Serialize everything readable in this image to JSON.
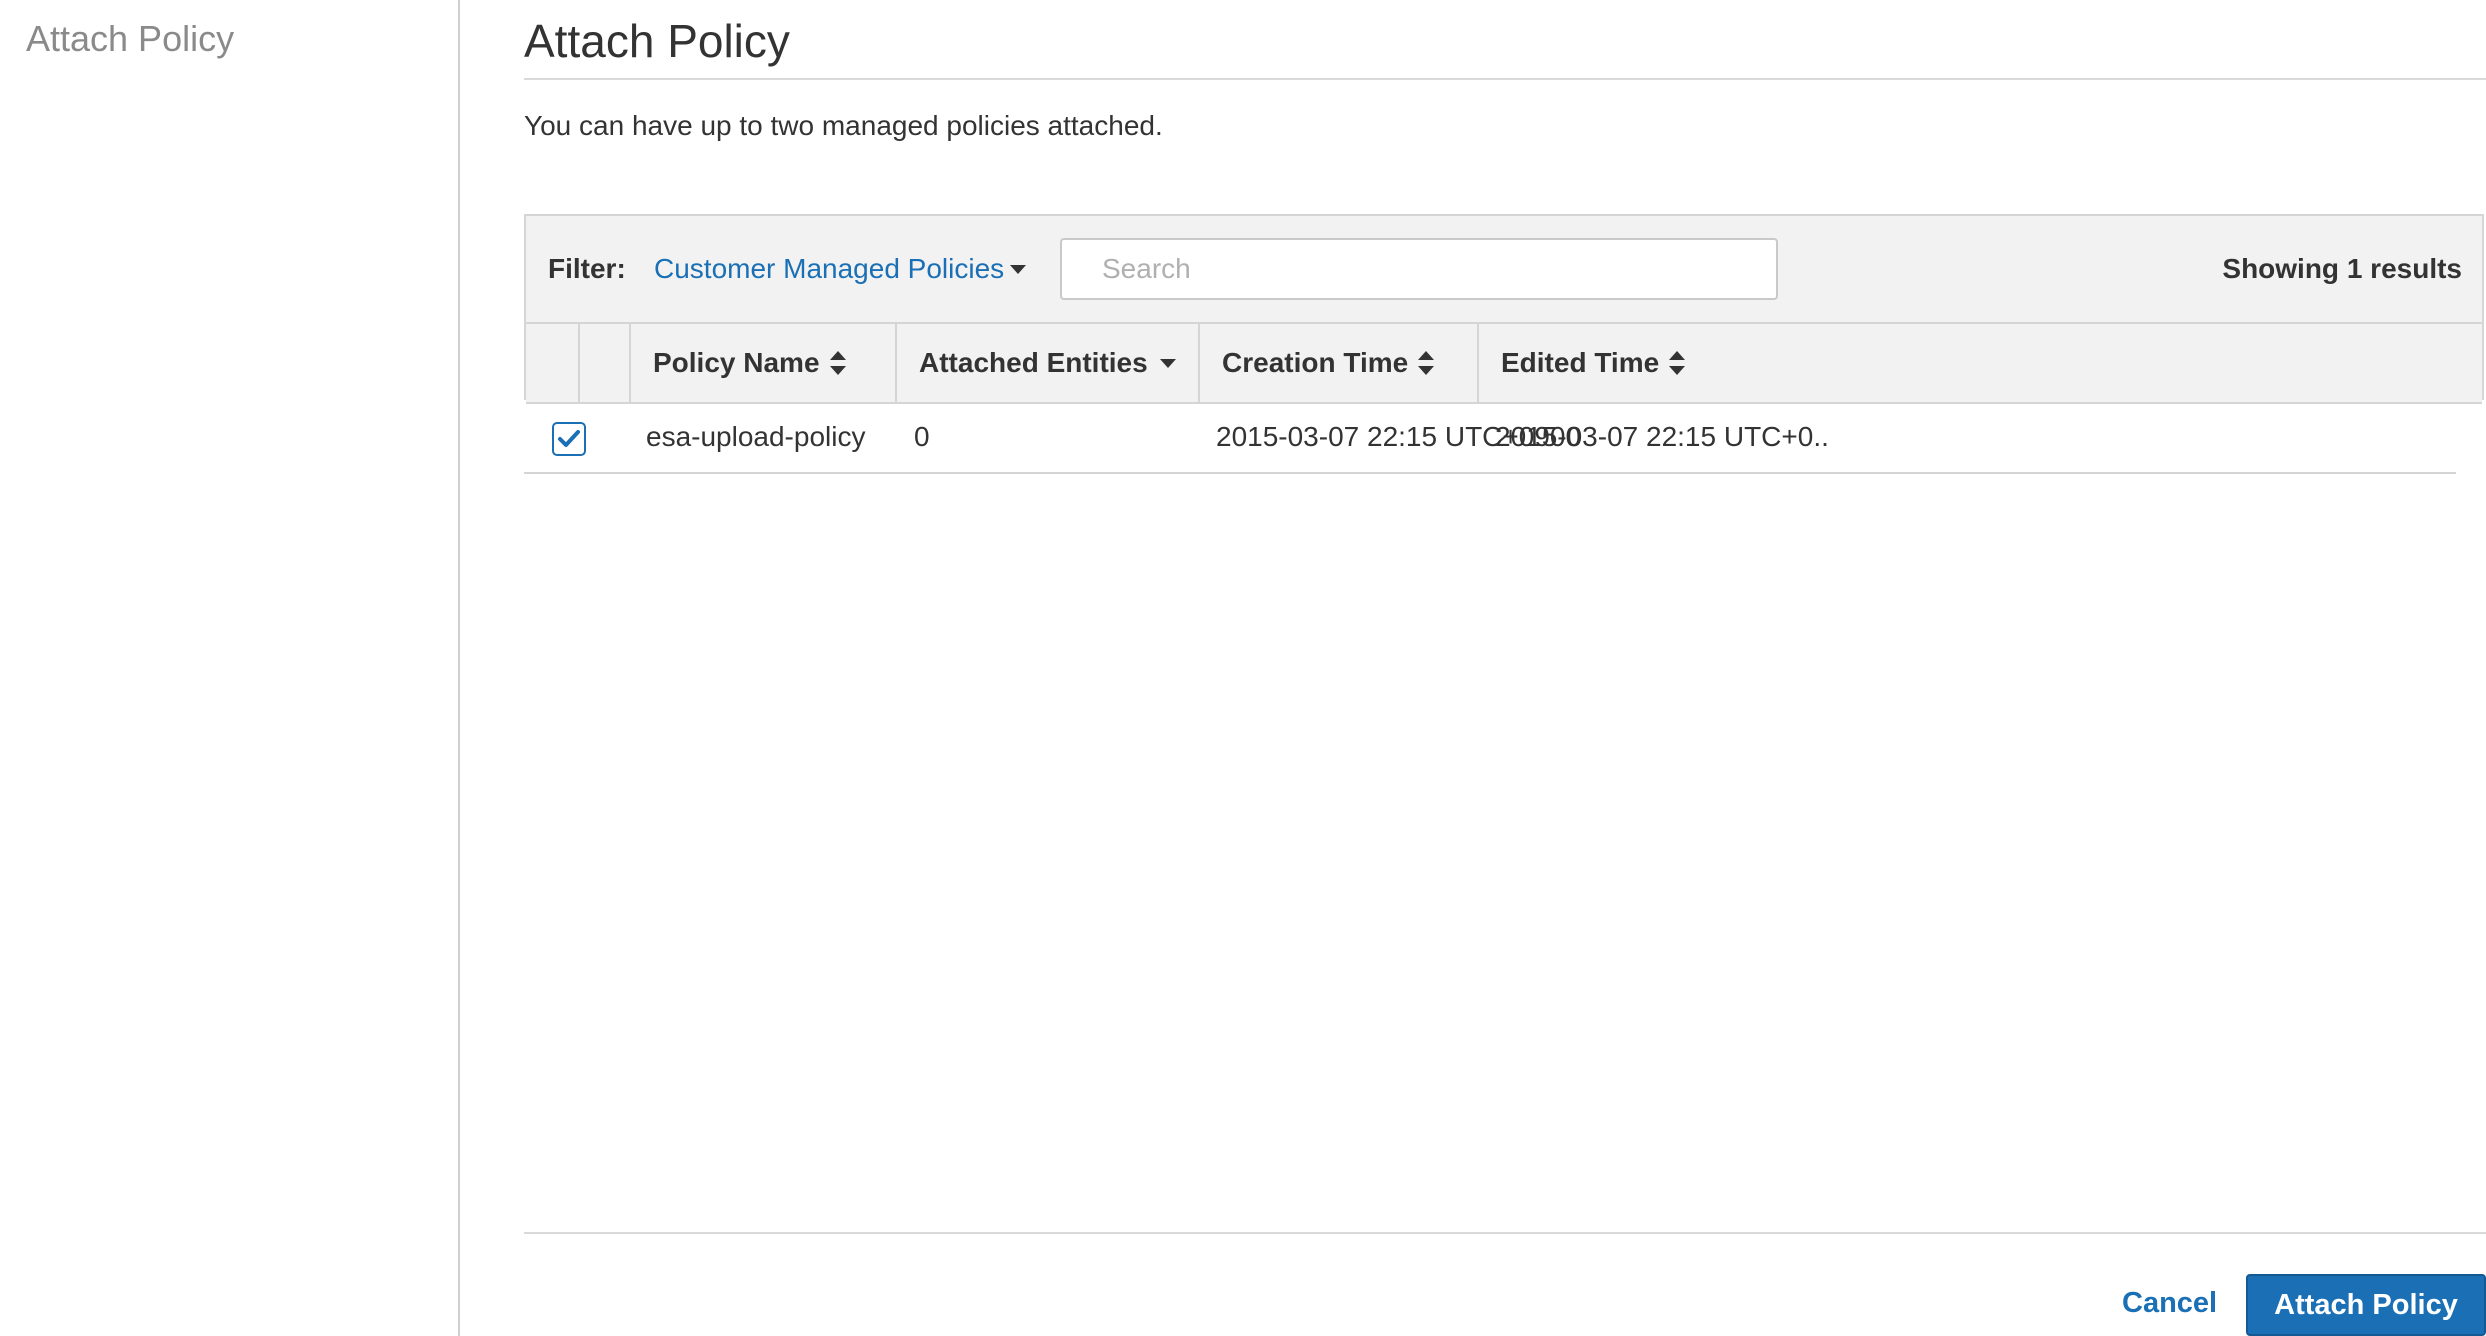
{
  "sidebar": {
    "title": "Attach Policy"
  },
  "page": {
    "title": "Attach Policy",
    "description": "You can have up to two managed policies attached."
  },
  "filter": {
    "label": "Filter:",
    "selected": "Customer Managed Policies",
    "search_placeholder": "Search",
    "search_value": "",
    "results": "Showing 1 results"
  },
  "table": {
    "columns": [
      "Policy Name",
      "Attached Entities",
      "Creation Time",
      "Edited Time"
    ],
    "rows": [
      {
        "checked": true,
        "policy_name": "esa-upload-policy",
        "attached_entities": "0",
        "creation_time": "2015-03-07 22:15 UTC+0900",
        "edited_time": "2015-03-07 22:15 UTC+0.."
      }
    ]
  },
  "footer": {
    "cancel_label": "Cancel",
    "attach_label": "Attach Policy"
  },
  "colors": {
    "accent": "#1a6fb5",
    "header_bg": "#f2f2f2",
    "border": "#d5d5d5"
  }
}
